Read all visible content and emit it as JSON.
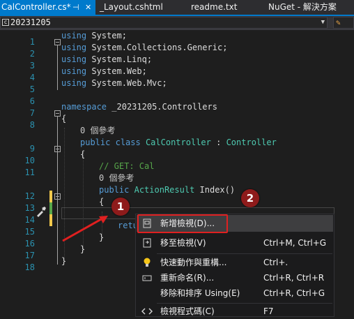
{
  "tabs": [
    {
      "label": "CalController.cs*"
    },
    {
      "label": "_Layout.cshtml"
    },
    {
      "label": "readme.txt"
    },
    {
      "label": "NuGet - 解決方案"
    }
  ],
  "nav": {
    "project": "20231205"
  },
  "code": {
    "line_numbers": [
      "1",
      "2",
      "3",
      "4",
      "5",
      "6",
      "7",
      "8",
      "9",
      "10",
      "11",
      "12",
      "13",
      "14",
      "15",
      "16",
      "17",
      "18"
    ],
    "using1": "System;",
    "using2": "System.Collections.Generic;",
    "using3": "System.Linq;",
    "using4": "System.Web;",
    "using5": "System.Web.Mvc;",
    "using_kw": "using",
    "namespace_kw": "namespace",
    "namespace_name": "_20231205.Controllers",
    "refs1": "0 個參考",
    "public_kw": "public",
    "class_kw": "class",
    "class_name": "CalController",
    "colon": ":",
    "base_class": "Controller",
    "comment": "// GET: Cal",
    "refs2": "0 個參考",
    "return_type": "ActionResult",
    "method": "Index()",
    "open_brace": "{",
    "close_brace": "}",
    "ret_partial": "retu"
  },
  "context_menu": {
    "items": [
      {
        "label": "新增檢視(D)...",
        "shortcut": ""
      },
      {
        "label": "移至檢視(V)",
        "shortcut": "Ctrl+M, Ctrl+G"
      },
      {
        "label": "快速動作與重構...",
        "shortcut": "Ctrl+."
      },
      {
        "label": "重新命名(R)...",
        "shortcut": "Ctrl+R, Ctrl+R"
      },
      {
        "label": "移除和排序 Using(E)",
        "shortcut": "Ctrl+R, Ctrl+G"
      },
      {
        "label": "檢視程式碼(C)",
        "shortcut": "F7"
      }
    ]
  },
  "annotations": {
    "step1": "1",
    "step2": "2"
  },
  "colors": {
    "accent": "#007acc",
    "highlight": "#e02020",
    "badge": "#8e1b1b"
  }
}
